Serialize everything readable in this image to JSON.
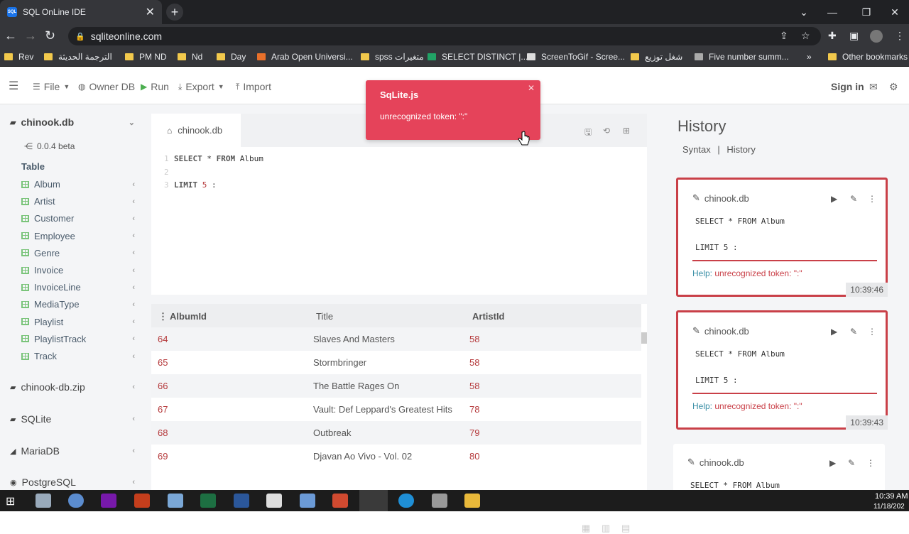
{
  "browser": {
    "tab_title": "SQL OnLine IDE",
    "favicon_text": "SQL",
    "url": "sqliteonline.com",
    "bookmarks": [
      "Rev",
      "الترجمة الحديثة",
      "PM ND",
      "Nd",
      "Day",
      "Arab Open Universi...",
      "spss متغيرات",
      "SELECT DISTINCT |...",
      "ScreenToGif - Scree...",
      "شغل توزيع",
      "Five number summ...",
      "»",
      "Other bookmarks"
    ]
  },
  "toolbar": {
    "file": "File",
    "owner_db": "Owner DB",
    "run": "Run",
    "export": "Export",
    "import": "Import",
    "sign_in": "Sign in"
  },
  "sidebar": {
    "db_name": "chinook.db",
    "version": "0.0.4 beta",
    "table_header": "Table",
    "tables": [
      "Album",
      "Artist",
      "Customer",
      "Employee",
      "Genre",
      "Invoice",
      "InvoiceLine",
      "MediaType",
      "Playlist",
      "PlaylistTrack",
      "Track"
    ],
    "other_dbs": [
      "chinook-db.zip",
      "SQLite",
      "MariaDB",
      "PostgreSQL"
    ]
  },
  "editor": {
    "tab_label": "chinook.db",
    "lines": [
      {
        "n": "1",
        "parts": [
          {
            "t": "SELECT",
            "c": "kw"
          },
          {
            "t": " * ",
            "c": ""
          },
          {
            "t": "FROM",
            "c": "kw"
          },
          {
            "t": " Album",
            "c": ""
          }
        ]
      },
      {
        "n": "2",
        "parts": []
      },
      {
        "n": "3",
        "parts": [
          {
            "t": "LIMIT",
            "c": "kw"
          },
          {
            "t": " ",
            "c": ""
          },
          {
            "t": "5",
            "c": "num"
          },
          {
            "t": " :",
            "c": ""
          }
        ]
      }
    ]
  },
  "grid": {
    "columns": [
      "AlbumId",
      "Title",
      "ArtistId"
    ],
    "rows": [
      [
        "64",
        "Slaves And Masters",
        "58"
      ],
      [
        "65",
        "Stormbringer",
        "58"
      ],
      [
        "66",
        "The Battle Rages On",
        "58"
      ],
      [
        "67",
        "Vault: Def Leppard's Greatest Hits",
        "78"
      ],
      [
        "68",
        "Outbreak",
        "79"
      ],
      [
        "69",
        "Djavan Ao Vivo - Vol. 02",
        "80"
      ]
    ]
  },
  "history": {
    "title": "History",
    "syntax": "Syntax",
    "sep": "|",
    "history_link": "History",
    "cards": [
      {
        "db": "chinook.db",
        "l1": "SELECT * FROM Album",
        "l3": "LIMIT 5 :",
        "help_label": "Help:",
        "help_msg": "unrecognized token: \":\"",
        "time": "10:39:46"
      },
      {
        "db": "chinook.db",
        "l1": "SELECT * FROM Album",
        "l3": "LIMIT 5 :",
        "help_label": "Help:",
        "help_msg": "unrecognized token: \":\"",
        "time": "10:39:43"
      },
      {
        "db": "chinook.db",
        "l1": "SELECT * FROM Album"
      }
    ]
  },
  "toast": {
    "title": "SqLite.js",
    "message": "unrecognized token: \":\""
  },
  "taskbar": {
    "time": "10:39 AM",
    "date": "11/18/202"
  }
}
